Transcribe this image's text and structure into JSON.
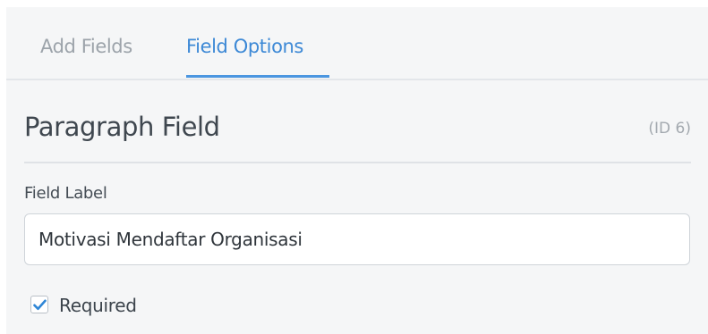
{
  "tabs": [
    {
      "label": "Add Fields",
      "active": false
    },
    {
      "label": "Field Options",
      "active": true
    }
  ],
  "field": {
    "title": "Paragraph Field",
    "id_label": "(ID 6)"
  },
  "field_label": {
    "label": "Field Label",
    "value": "Motivasi Mendaftar Organisasi"
  },
  "required": {
    "label": "Required",
    "checked": true
  },
  "colors": {
    "accent": "#4b96e0",
    "check": "#2f86d6"
  }
}
